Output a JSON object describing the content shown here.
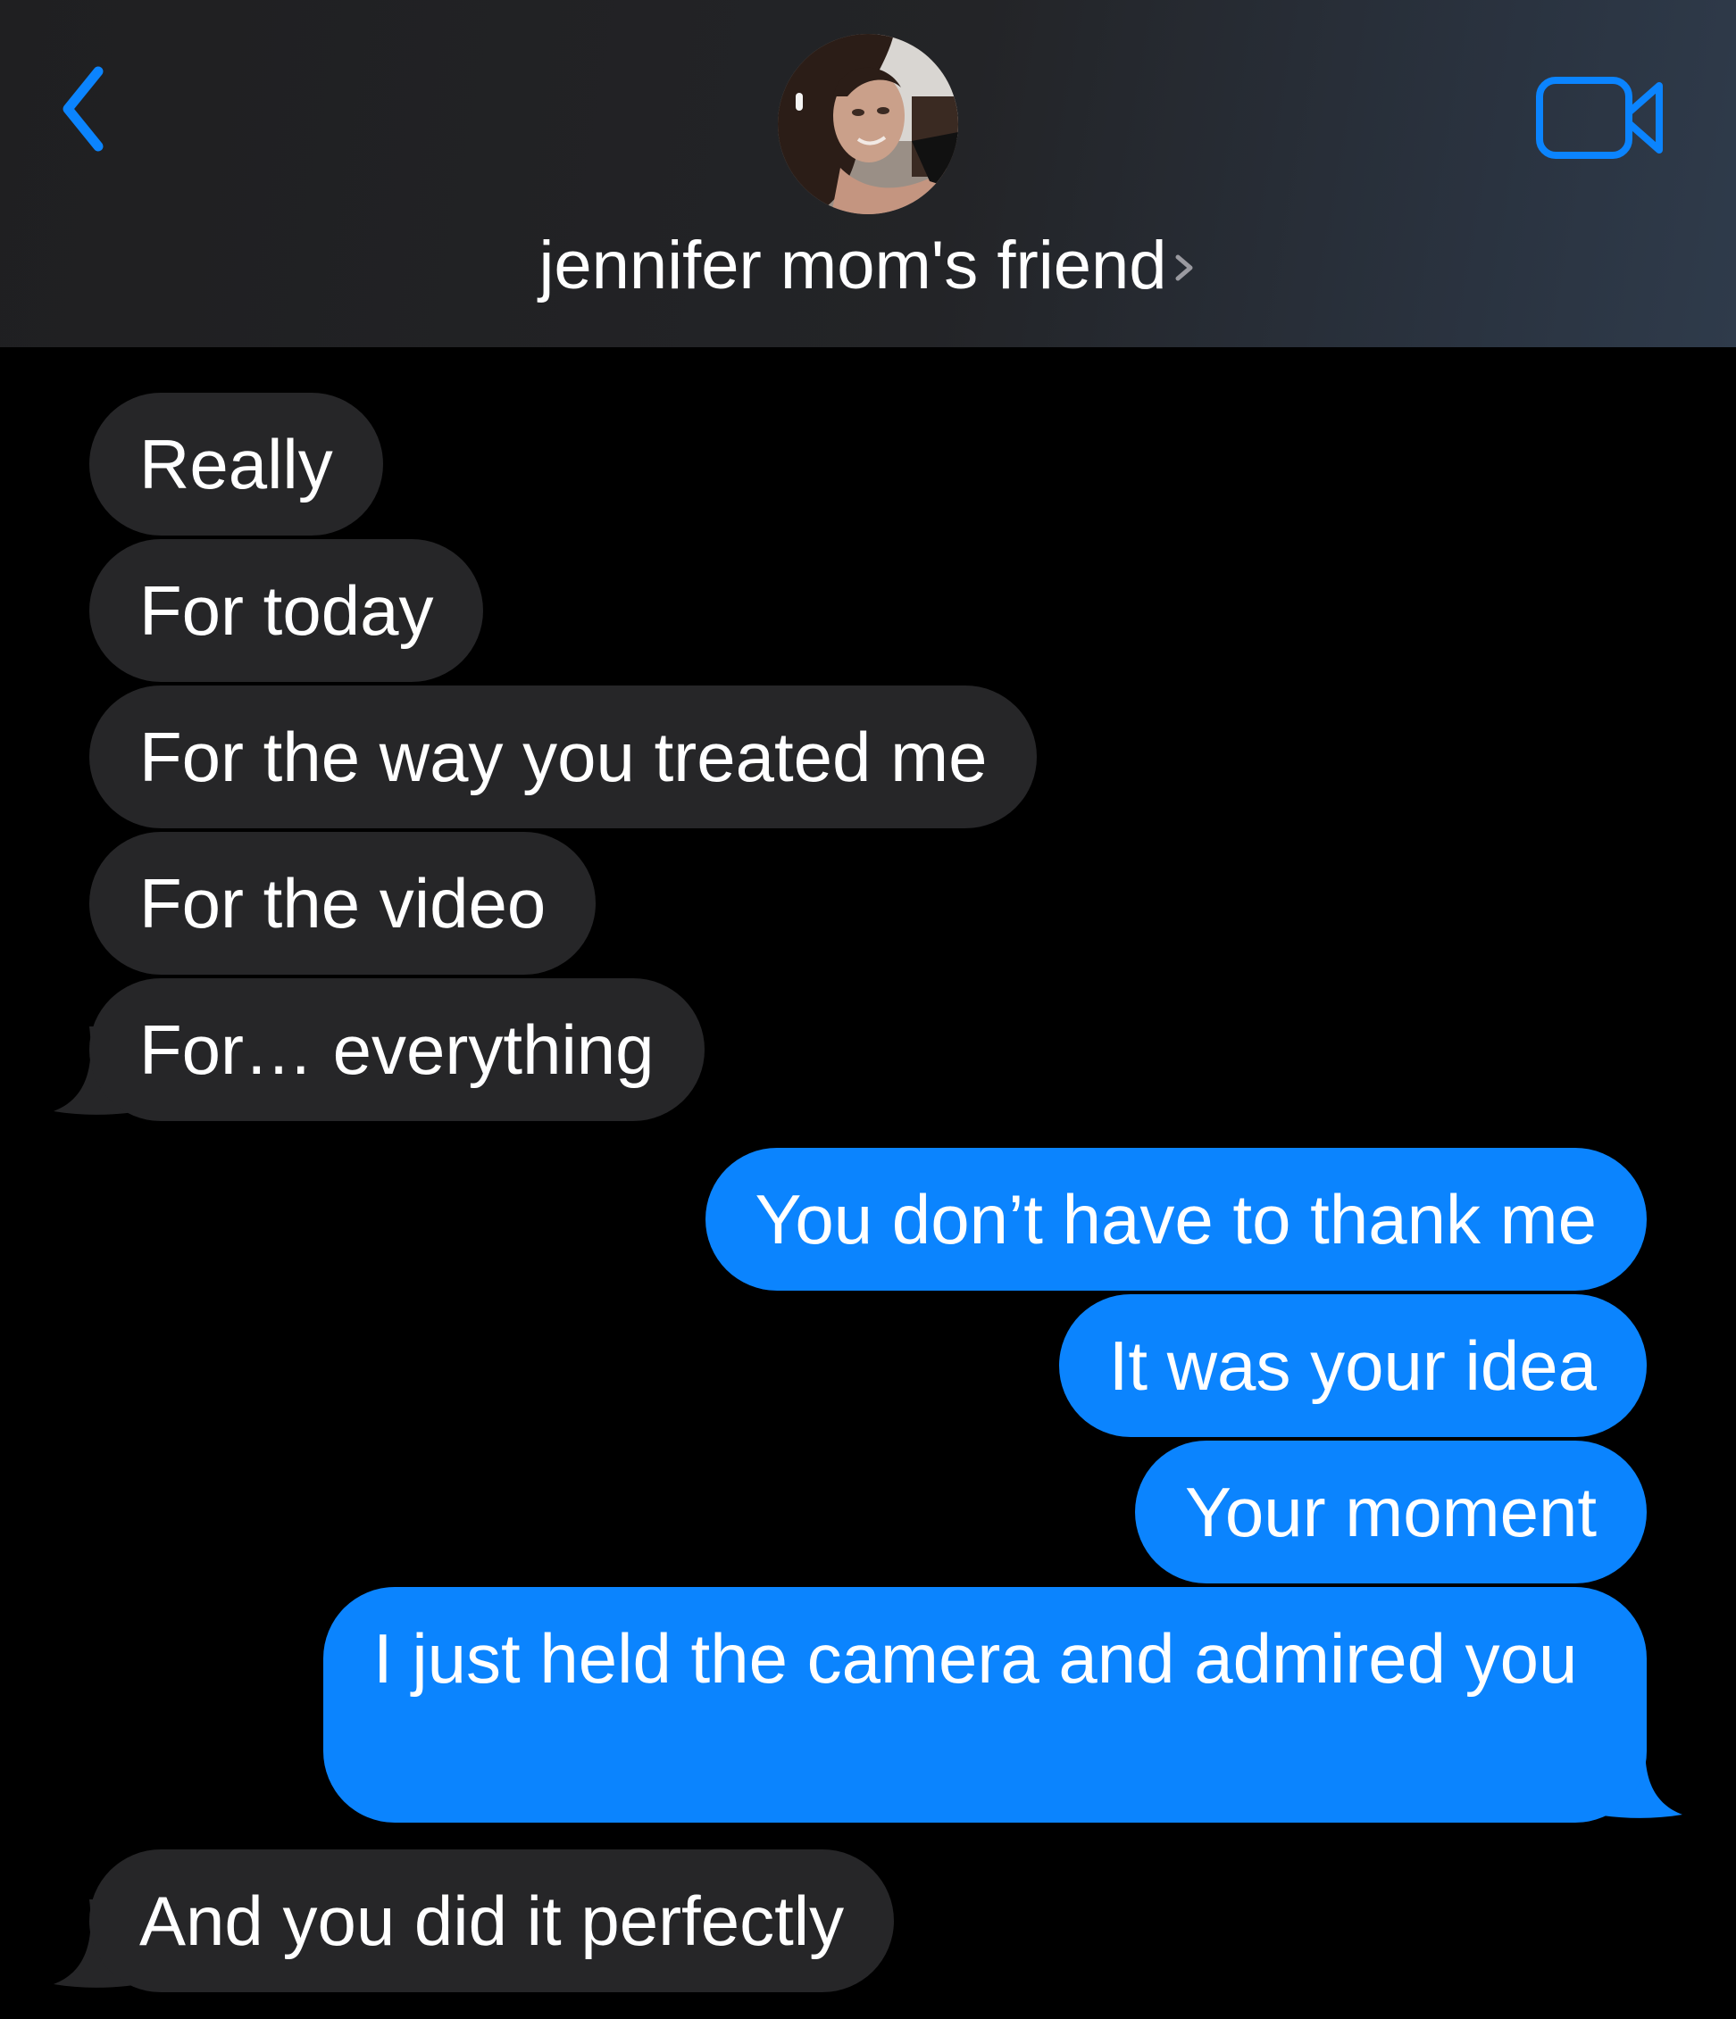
{
  "header": {
    "contact_name": "jennifer mom's friend",
    "accent_color": "#0b84fe",
    "back_icon": "chevron-left-icon",
    "video_icon": "video-camera-icon",
    "disclosure_icon": "chevron-right-icon"
  },
  "messages": [
    {
      "direction": "received",
      "text": "Really"
    },
    {
      "direction": "received",
      "text": "For today"
    },
    {
      "direction": "received",
      "text": "For the way you treated me"
    },
    {
      "direction": "received",
      "text": "For the video"
    },
    {
      "direction": "received",
      "text": "For… everything"
    },
    {
      "direction": "sent",
      "text": "You don’t have to thank me"
    },
    {
      "direction": "sent",
      "text": "It was your idea"
    },
    {
      "direction": "sent",
      "text": "Your moment"
    },
    {
      "direction": "sent",
      "text": "I just held the camera and admired you"
    },
    {
      "direction": "received",
      "text": "And you did it perfectly"
    }
  ],
  "colors": {
    "received_bubble": "#262628",
    "sent_bubble": "#0b84fe",
    "background": "#000000"
  }
}
